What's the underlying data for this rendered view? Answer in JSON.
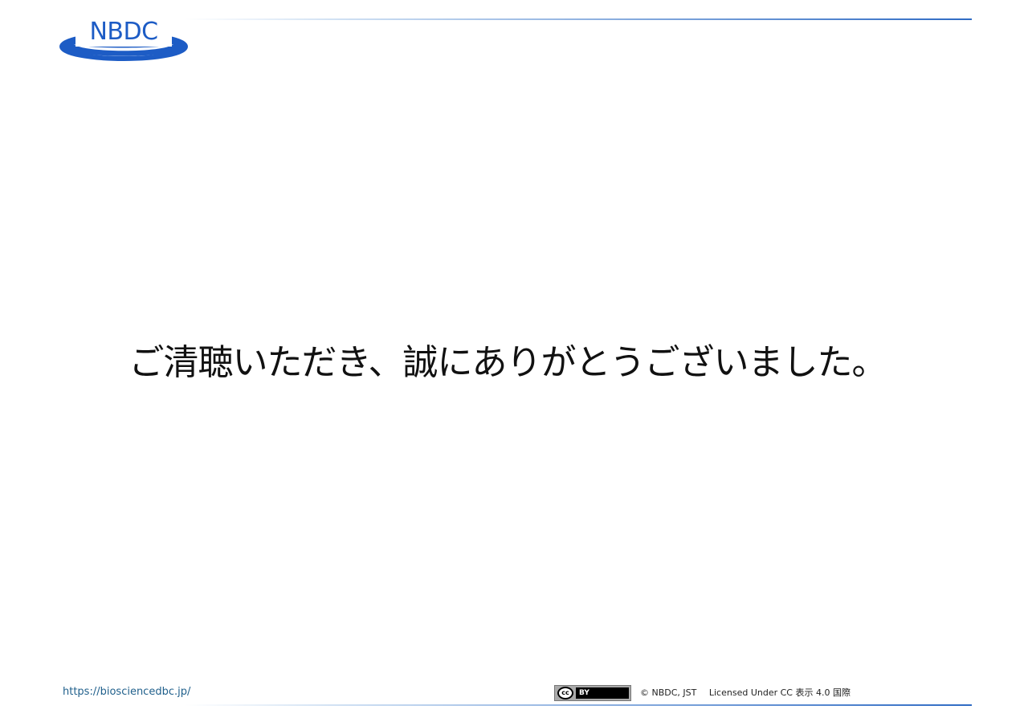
{
  "header": {
    "logo_text": "NBDC",
    "brand_color": "#1d5cc5"
  },
  "main": {
    "message": "ご清聴いただき、誠にありがとうございました。"
  },
  "footer": {
    "url": "https://biosciencedbc.jp/",
    "cc_badge": {
      "circle_text": "cc",
      "by_text": "BY"
    },
    "copyright": "© NBDC, JST",
    "license_text": "Licensed Under CC 表示 4.0 国際"
  }
}
